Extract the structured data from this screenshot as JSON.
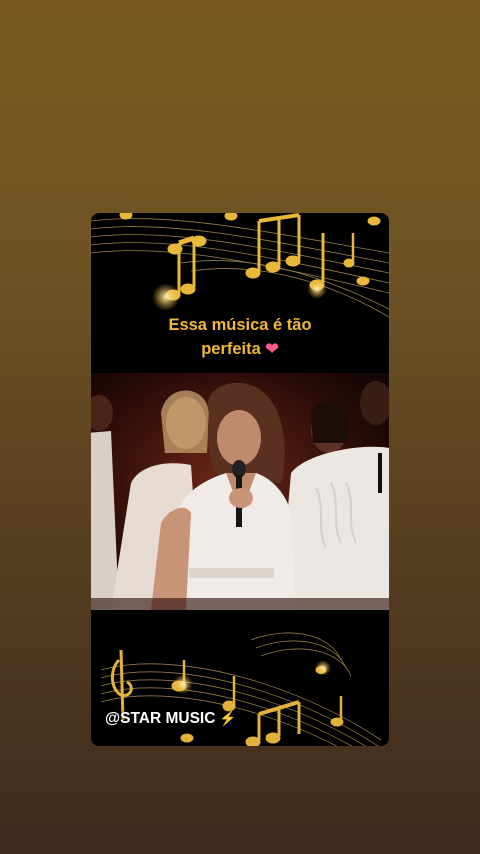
{
  "post": {
    "caption_line1": "Essa música é tão",
    "caption_line2": "perfeita",
    "caption_emoji": "❤",
    "handle": "@STAR MUSIC",
    "handle_emoji": "⚡"
  },
  "colors": {
    "background_top": "#7a5a22",
    "background_bottom": "#3e2a1e",
    "caption": "#f2b836",
    "gold": "#e8b83a"
  },
  "icons": [
    "music-notes-icon",
    "heart-icon",
    "lightning-icon",
    "treble-clef-icon"
  ]
}
